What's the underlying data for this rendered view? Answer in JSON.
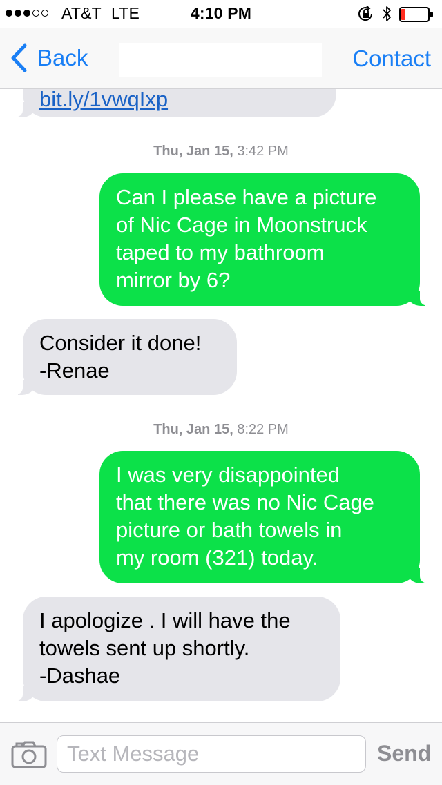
{
  "status_bar": {
    "carrier": "AT&T",
    "network": "LTE",
    "time": "4:10 PM",
    "signal_bars_filled": 3,
    "signal_bars_total": 5,
    "battery_level": 0.15,
    "battery_color": "#ff2d20",
    "icons": [
      "orientation-lock-icon",
      "bluetooth-icon",
      "battery-icon"
    ]
  },
  "nav": {
    "back_label": "Back",
    "contact_label": "Contact",
    "accent_color": "#1a7ff5"
  },
  "thread": {
    "partial_link": "bit.ly/1vwqIxp",
    "messages": [
      {
        "timestamp_day": "Thu, Jan 15,",
        "timestamp_time": " 3:42 PM",
        "direction": "sent",
        "lines": [
          "Can I please have a picture",
          "of Nic Cage in Moonstruck",
          "taped to my bathroom",
          "mirror by 6?"
        ]
      },
      {
        "direction": "received",
        "lines": [
          "Consider it done!",
          "-Renae"
        ]
      },
      {
        "timestamp_day": "Thu, Jan 15,",
        "timestamp_time": " 8:22 PM",
        "direction": "sent",
        "lines": [
          "I was very disappointed",
          "that there was no Nic Cage",
          "picture or bath towels in",
          "my room (321) today."
        ]
      },
      {
        "direction": "received",
        "lines": [
          "I apologize . I will have the",
          "towels sent up shortly.",
          "-Dashae"
        ]
      }
    ],
    "sent_color": "#0ce149",
    "received_color": "#e5e5ea"
  },
  "input": {
    "placeholder": "Text Message",
    "value": "",
    "send_label": "Send"
  }
}
